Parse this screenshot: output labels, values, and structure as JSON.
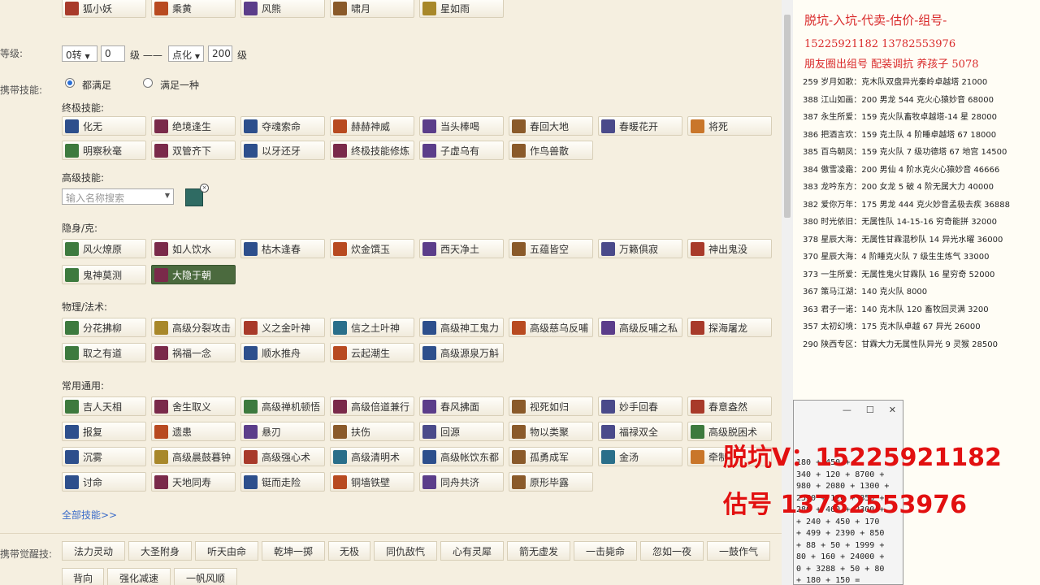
{
  "top_pets": [
    "狐小妖",
    "乘黄",
    "风熊",
    "啸月",
    "星如雨"
  ],
  "side": {
    "level_label": "等级:",
    "skills_label": "携带技能:",
    "awaken_label": "携带觉醒技:"
  },
  "level": {
    "select_zhuan": "0转",
    "input_from": "0",
    "unit1": "级 ——",
    "select_dianhua": "点化",
    "input_to": "200",
    "unit2": "级"
  },
  "radio": {
    "all": "都满足",
    "one": "满足一种"
  },
  "sections": {
    "ultimate": "终极技能:",
    "advanced": "高级技能:",
    "stealth": "隐身/克:",
    "physmag": "物理/法术:",
    "common": "常用通用:",
    "all_link": "全部技能>>"
  },
  "search_placeholder": "输入名称搜索",
  "ultimate_row1": [
    "化无",
    "绝境逢生",
    "夺魂索命",
    "赫赫神威",
    "当头棒喝",
    "春回大地",
    "春暖花开",
    "将死"
  ],
  "ultimate_row2": [
    "明察秋毫",
    "双管齐下",
    "以牙还牙",
    "终极技能修炼",
    "子虚乌有",
    "作鸟兽散"
  ],
  "stealth_row1": [
    "风火燎原",
    "如人饮水",
    "枯木逢春",
    "炊金馔玉",
    "西天净土",
    "五蕴皆空",
    "万籁俱寂",
    "神出鬼没"
  ],
  "stealth_row2": [
    "鬼神莫测",
    "大隐于朝"
  ],
  "phys_row1": [
    "分花拂柳",
    "高级分裂攻击",
    "义之金叶神",
    "信之土叶神",
    "高级神工鬼力",
    "高级慈乌反哺",
    "高级反哺之私",
    "探海屠龙"
  ],
  "phys_row2": [
    "取之有道",
    "祸福一念",
    "顺水推舟",
    "云起潮生",
    "高级源泉万斛"
  ],
  "common_row1": [
    "吉人天相",
    "舍生取义",
    "高级禅机顿悟",
    "高级倍道兼行",
    "春风拂面",
    "视死如归",
    "妙手回春",
    "春意盎然"
  ],
  "common_row2": [
    "报复",
    "遗患",
    "悬刃",
    "扶伤",
    "回源",
    "物以类聚",
    "福禄双全",
    "高级脱困术"
  ],
  "common_row3": [
    "沉雾",
    "高级晨鼓暮钟",
    "高级强心术",
    "高级清明术",
    "高级帐饮东都",
    "孤勇成军",
    "金汤",
    "牵制"
  ],
  "common_row4": [
    "讨命",
    "天地同寿",
    "铤而走险",
    "铜墙铁壁",
    "同舟共济",
    "原形毕露"
  ],
  "awaken_row1": [
    "法力灵动",
    "大圣附身",
    "听天由命",
    "乾坤一掷",
    "无极",
    "同仇敌忾",
    "心有灵犀",
    "箭无虚发",
    "一击毙命",
    "忽如一夜",
    "一鼓作气"
  ],
  "awaken_row2": [
    "背向",
    "强化减速",
    "一帆风顺"
  ],
  "note": {
    "title": "脱坑-入坑-代卖-估价-组号-",
    "phones": "15225921182   13782553976",
    "line3": "朋友圈出组号   配装调抗  养孩子 5078",
    "entries": [
      "259 岁月如歌：克木队双盘异光秦岭卓越塔 21000",
      "388 江山如画：200 男龙 544 克火心猿妙音 68000",
      "387 永生所爱：159 克火队畜牧卓越塔-14 星 28000",
      "386 把酒言欢：159 克土队 4 阶睡卓越塔 67  18000",
      "385 百鸟朝凤：159 克火队 7 级功德塔 67 地宫 14500",
      "384 傲雪凌霜：200 男仙 4 阶水克火心猿妙音 46666",
      "383 龙吟东方：200 女龙 5 破 4 阶无属大力 40000",
      "382 爱你万年：175 男龙 444 克火妙音孟极去疾 36888",
      "380 时光依旧：无属性队 14-15-16 穷奇能拼 32000",
      "378 星辰大海：无属性甘霖混秒队 14 异光水曜 36000",
      "370 星辰大海：4 阶睡克火队 7 级生生炼气 33000",
      "373 一生所爱：无属性鬼火甘霖队 16 星穷奇 52000",
      "367 策马江湖：140 克火队 8000",
      "363 君子一诺：140 克木队 120 畜牧回灵满 3200",
      "357 太初幻境：175 克木队卓越 67 异光 26000",
      "290 陕西专区：甘霖大力无属性队异光 9 灵猴 28500"
    ]
  },
  "calc": {
    "minimize": "—",
    "maximize": "☐",
    "close": "✕",
    "lines": [
      "180  +  450  +",
      "340  +  120  +  8700  +",
      "980  +  2080  +  1300  +",
      "2550  +  120  +  850  +",
      "280  +  460  +  2300  +",
      "+  240  +  450  +  170",
      "+  499  +  2390  +  850",
      "+  88  +  50  +  1999  +",
      "80  +  160  +  24000  +",
      "0  +  3288  +  50  +  80",
      "+  180  +  150  ="
    ]
  },
  "overlay": {
    "line1": "脱坑V：15225921182",
    "line2": "估号   13782553976"
  },
  "colors": {
    "selected_btn": "#4b6a3e",
    "highlight_red": "#e21010",
    "link_blue": "#3a6bc9"
  }
}
